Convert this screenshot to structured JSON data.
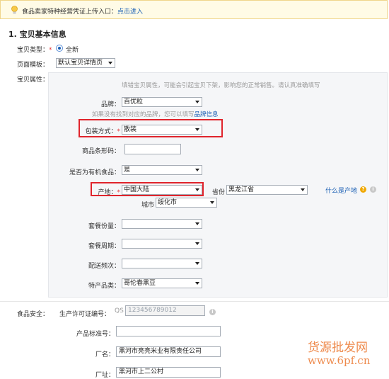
{
  "notice": {
    "text": "食品卖家特种经营凭证上传入口：",
    "link": "点击进入"
  },
  "section_title": "1. 宝贝基本信息",
  "item_type": {
    "label": "宝贝类型：",
    "required_mark": "*",
    "option": "全新"
  },
  "page_template": {
    "label": "页面模板：",
    "value": "默认宝贝详情页"
  },
  "attributes_label": "宝贝属性：",
  "attributes_hint": "填错宝贝属性，可能会引起宝贝下架，影响您的正常销售。请认真准确填写",
  "brand": {
    "label": "品牌：",
    "value": "百优粒"
  },
  "brand_hint": {
    "text": "如果没有找到对应的品牌，您可以填写",
    "link": "品牌信息"
  },
  "packaging": {
    "label": "包装方式：",
    "required_mark": "*",
    "value": "散装"
  },
  "barcode": {
    "label": "商品条形码：",
    "value": ""
  },
  "organic": {
    "label": "是否为有机食品：",
    "value": "是"
  },
  "origin": {
    "label": "产地：",
    "required_mark": "*",
    "value": "中国大陆"
  },
  "province": {
    "label": "省份",
    "value": "黑龙江省"
  },
  "city": {
    "label": "城市",
    "value": "绥化市"
  },
  "origin_help": "什么是产地",
  "package_qty": {
    "label": "套餐份量：",
    "value": ""
  },
  "package_period": {
    "label": "套餐周期：",
    "value": ""
  },
  "delivery_freq": {
    "label": "配送频次：",
    "value": ""
  },
  "specialty": {
    "label": "特产品类：",
    "value": "哥伦春黑豆"
  },
  "food_safety": {
    "label": "食品安全：",
    "license_label": "生产许可证编号：",
    "license_prefix": "QS",
    "license_placeholder": "123456789012"
  },
  "product_standard": {
    "label": "产品标准号：",
    "value": ""
  },
  "factory_name": {
    "label": "厂名：",
    "value": "黑河市亮亮米业有限责任公司"
  },
  "factory_address": {
    "label": "厂址：",
    "value": "黑河市上二公村"
  },
  "watermark": {
    "line1": "货源批发网",
    "line2": "www.6pf.cn"
  },
  "colors": {
    "highlight_box": "#e0242c",
    "link": "#1a5fb4",
    "notice_bg": "#fffbe6"
  }
}
